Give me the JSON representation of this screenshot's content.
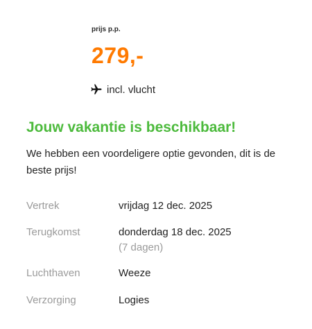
{
  "price": {
    "label": "prijs p.p.",
    "value": "279,-"
  },
  "flight": {
    "icon": "plane-icon",
    "text": "incl. vlucht"
  },
  "availability": {
    "headline": "Jouw vakantie is beschikbaar!",
    "message": "We hebben een voordeligere optie gevonden, dit is de beste prijs!"
  },
  "details": [
    {
      "label": "Vertrek",
      "value": "vrijdag 12 dec. 2025"
    },
    {
      "label": "Terugkomst",
      "value": "donderdag 18 dec. 2025",
      "sub": "(7 dagen)"
    },
    {
      "label": "Luchthaven",
      "value": "Weeze"
    },
    {
      "label": "Verzorging",
      "value": "Logies"
    }
  ],
  "colors": {
    "price": "#ff7a00",
    "headline": "#4cba3c",
    "label": "#9a9a9a"
  }
}
